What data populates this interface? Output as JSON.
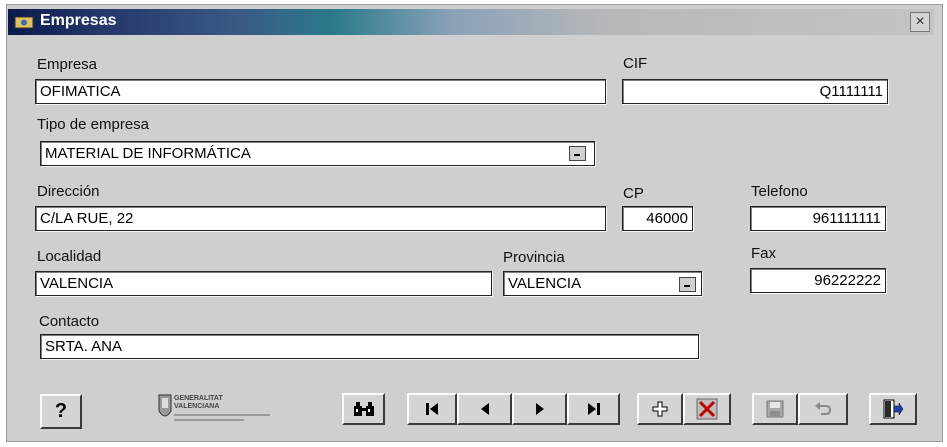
{
  "window": {
    "title": "Empresas",
    "close_glyph": "×"
  },
  "form": {
    "empresa": {
      "label": "Empresa",
      "value": "OFIMATICA"
    },
    "cif": {
      "label": "CIF",
      "value": "Q1111111"
    },
    "tipo": {
      "label": "Tipo de empresa",
      "value": "MATERIAL DE INFORMÁTICA"
    },
    "direccion": {
      "label": "Dirección",
      "value": "C/LA RUE, 22"
    },
    "cp": {
      "label": "CP",
      "value": "46000"
    },
    "telefono": {
      "label": "Telefono",
      "value": "961111111"
    },
    "localidad": {
      "label": "Localidad",
      "value": "VALENCIA"
    },
    "provincia": {
      "label": "Provincia",
      "value": "VALENCIA"
    },
    "fax": {
      "label": "Fax",
      "value": "96222222"
    },
    "contacto": {
      "label": "Contacto",
      "value": "SRTA. ANA"
    }
  },
  "logo": {
    "lines": [
      "GENERALITAT",
      "VALENCIANA"
    ]
  },
  "toolbar": {
    "help_glyph": "?",
    "icons": [
      "help-icon",
      "binoculars-icon",
      "first-record-icon",
      "previous-record-icon",
      "next-record-icon",
      "last-record-icon",
      "add-icon",
      "delete-icon",
      "save-icon",
      "undo-icon",
      "exit-icon"
    ]
  },
  "colors": {
    "titlebar_start": "#0a1a4a",
    "titlebar_end": "#c4c4c4",
    "window_bg": "#cfcfcf",
    "field_bg": "#ffffff",
    "delete_red": "#c00000"
  }
}
